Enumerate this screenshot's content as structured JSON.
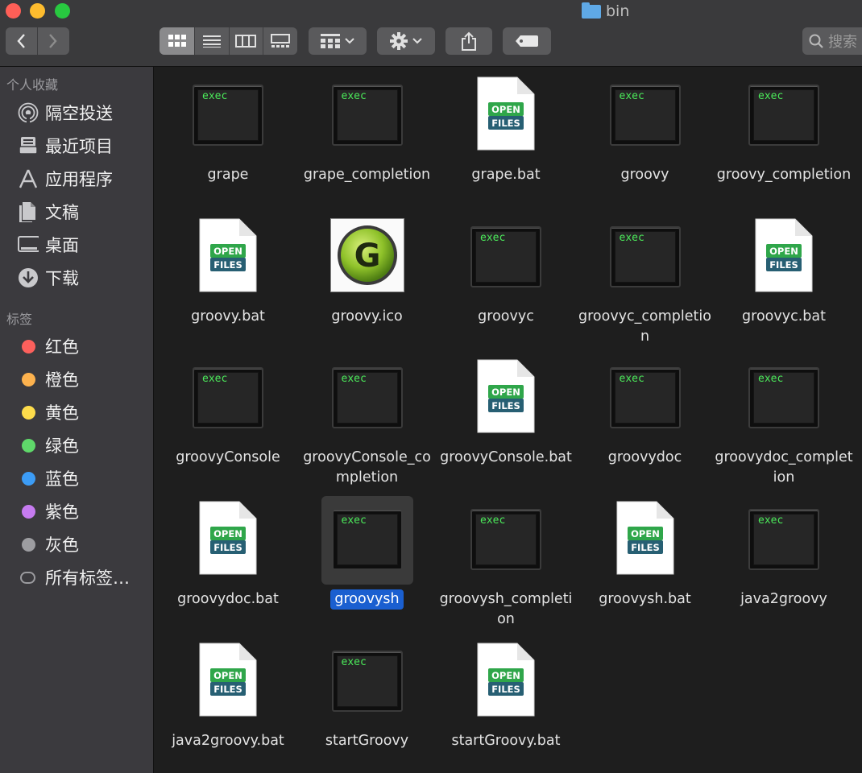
{
  "window": {
    "title": "bin"
  },
  "toolbar": {
    "back": "‹",
    "forward": "›",
    "search_placeholder": "搜索"
  },
  "sidebar": {
    "favorites_title": "个人收藏",
    "favorites": [
      {
        "label": "隔空投送",
        "icon": "airdrop-icon"
      },
      {
        "label": "最近项目",
        "icon": "recents-icon"
      },
      {
        "label": "应用程序",
        "icon": "applications-icon"
      },
      {
        "label": "文稿",
        "icon": "documents-icon"
      },
      {
        "label": "桌面",
        "icon": "desktop-icon"
      },
      {
        "label": "下载",
        "icon": "downloads-icon"
      }
    ],
    "tags_title": "标签",
    "tags": [
      {
        "label": "红色",
        "color": "#fc605c"
      },
      {
        "label": "橙色",
        "color": "#fdb24e"
      },
      {
        "label": "黄色",
        "color": "#fddc4b"
      },
      {
        "label": "绿色",
        "color": "#5fd86a"
      },
      {
        "label": "蓝色",
        "color": "#3c9cf6"
      },
      {
        "label": "紫色",
        "color": "#c67bf0"
      },
      {
        "label": "灰色",
        "color": "#9d9da1"
      },
      {
        "label": "所有标签…",
        "color": ""
      }
    ]
  },
  "files": [
    {
      "name": "grape",
      "type": "exec"
    },
    {
      "name": "grape_completion",
      "type": "exec"
    },
    {
      "name": "grape.bat",
      "type": "bat"
    },
    {
      "name": "groovy",
      "type": "exec"
    },
    {
      "name": "groovy_completion",
      "type": "exec"
    },
    {
      "name": "groovy.bat",
      "type": "bat"
    },
    {
      "name": "groovy.ico",
      "type": "ico"
    },
    {
      "name": "groovyc",
      "type": "exec"
    },
    {
      "name": "groovyc_completion",
      "type": "exec"
    },
    {
      "name": "groovyc.bat",
      "type": "bat"
    },
    {
      "name": "groovyConsole",
      "type": "exec"
    },
    {
      "name": "groovyConsole_completion",
      "type": "exec"
    },
    {
      "name": "groovyConsole.bat",
      "type": "bat"
    },
    {
      "name": "groovydoc",
      "type": "exec"
    },
    {
      "name": "groovydoc_completion",
      "type": "exec"
    },
    {
      "name": "groovydoc.bat",
      "type": "bat"
    },
    {
      "name": "groovysh",
      "type": "exec",
      "selected": true
    },
    {
      "name": "groovysh_completion",
      "type": "exec"
    },
    {
      "name": "groovysh.bat",
      "type": "bat"
    },
    {
      "name": "java2groovy",
      "type": "exec"
    },
    {
      "name": "java2groovy.bat",
      "type": "bat"
    },
    {
      "name": "startGroovy",
      "type": "exec"
    },
    {
      "name": "startGroovy.bat",
      "type": "bat"
    }
  ],
  "icon_labels": {
    "exec": "exec",
    "open": "OPEN",
    "files": "FILES",
    "ico_letter": "G"
  }
}
